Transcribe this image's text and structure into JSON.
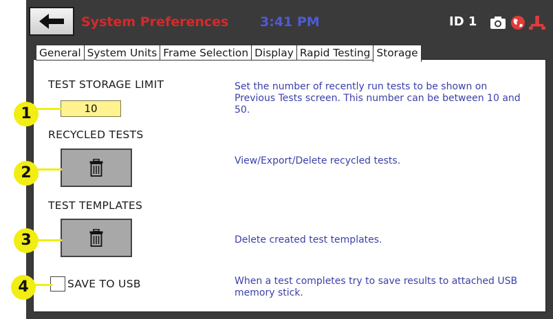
{
  "header": {
    "title": "System Preferences",
    "time": "3:41 PM",
    "id_label": "ID 1",
    "icons": [
      "arrow-left-icon",
      "camera-icon",
      "globe-icon",
      "test-frame-icon"
    ]
  },
  "tabs": [
    {
      "label": "General"
    },
    {
      "label": "System Units"
    },
    {
      "label": "Frame Selection"
    },
    {
      "label": "Display"
    },
    {
      "label": "Rapid Testing"
    },
    {
      "label": "Storage",
      "active": true
    }
  ],
  "storage": {
    "limit_label": "TEST STORAGE LIMIT",
    "limit_value": "10",
    "limit_desc": "Set the number of recently run tests to be shown on Previous Tests screen. This number can be between 10 and 50.",
    "recycled_label": "RECYCLED TESTS",
    "recycled_desc": "View/Export/Delete recycled tests.",
    "templates_label": "TEST TEMPLATES",
    "templates_desc": "Delete created test templates.",
    "usb_label": "SAVE TO USB",
    "usb_checked": false,
    "usb_desc": "When a test completes try to save results to attached USB memory stick."
  },
  "callouts": [
    "1",
    "2",
    "3",
    "4"
  ],
  "colors": {
    "title_red": "#d42a2a",
    "time_blue": "#4f5ad9",
    "desc_blue": "#3a3fa8",
    "callout_yellow": "#f2ed12",
    "input_yellow": "#fff28f"
  }
}
